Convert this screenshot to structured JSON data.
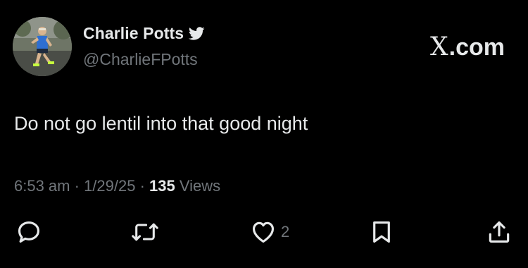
{
  "author": {
    "display_name": "Charlie Potts",
    "handle": "@CharlieFPotts",
    "verified": true,
    "avatar_icon": "runner-photo"
  },
  "brand": {
    "logo_letter": "X",
    "logo_suffix": ".com"
  },
  "tweet": {
    "text": "Do not go lentil into that good night"
  },
  "meta": {
    "time": "6:53 am",
    "separator_1": " · ",
    "date": "1/29/25",
    "separator_2": " · ",
    "views_count": "135",
    "views_label": " Views"
  },
  "actions": {
    "reply_icon": "reply-icon",
    "retweet_icon": "retweet-icon",
    "like_icon": "heart-icon",
    "like_count": "2",
    "bookmark_icon": "bookmark-icon",
    "share_icon": "share-icon"
  },
  "colors": {
    "background": "#000000",
    "primary_text": "#e7e9ea",
    "secondary_text": "#71767b"
  }
}
